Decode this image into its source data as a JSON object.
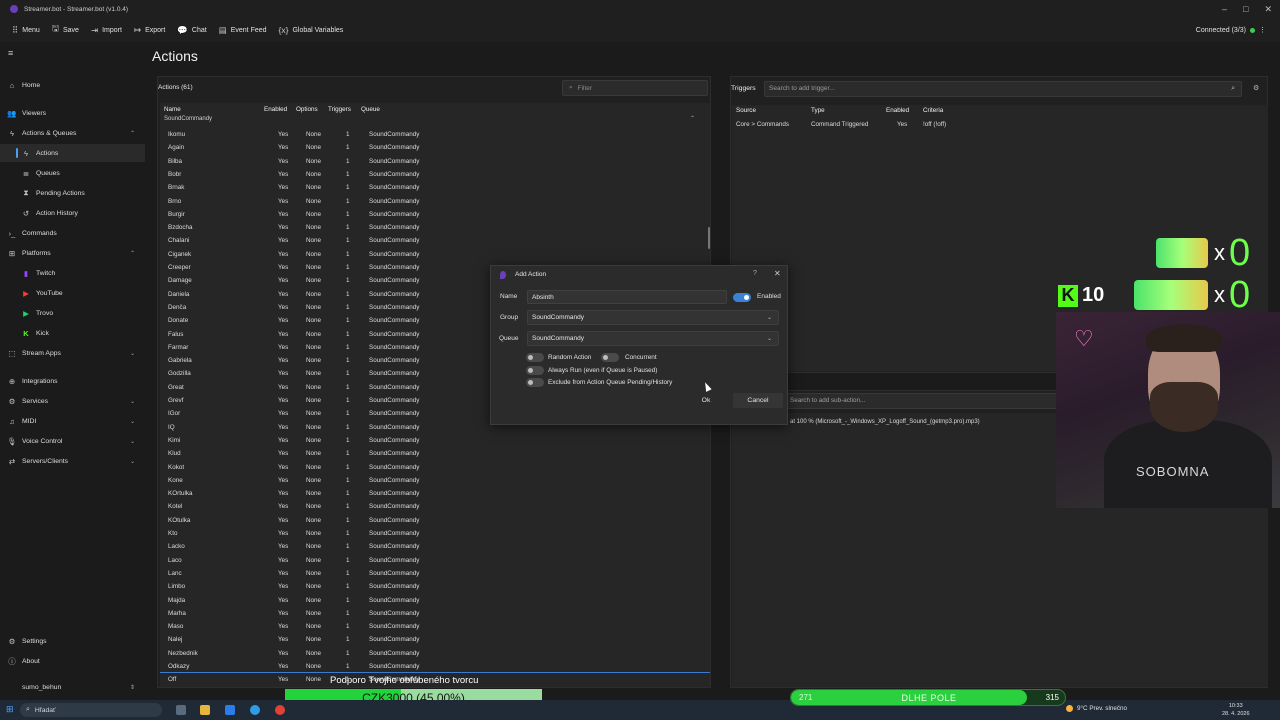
{
  "window": {
    "title": "Streamer.bot - Streamer.bot (v1.0.4)"
  },
  "toolbar": {
    "items": [
      {
        "label": "Menu",
        "icon": "grid-icon"
      },
      {
        "label": "Save",
        "icon": "save-icon"
      },
      {
        "label": "Import",
        "icon": "import-icon"
      },
      {
        "label": "Export",
        "icon": "export-icon"
      },
      {
        "label": "Chat",
        "icon": "chat-icon"
      },
      {
        "label": "Event Feed",
        "icon": "feed-icon"
      },
      {
        "label": "Global Variables",
        "icon": "variables-icon"
      }
    ],
    "connection": "Connected (3/3)"
  },
  "sidebar": {
    "items": [
      {
        "label": "Home",
        "icon": "home-icon"
      },
      {
        "label": "Viewers",
        "icon": "viewers-icon"
      },
      {
        "label": "Actions & Queues",
        "icon": "actions-icon"
      },
      {
        "label": "Actions",
        "icon": "bolt-icon"
      },
      {
        "label": "Queues",
        "icon": "queue-icon"
      },
      {
        "label": "Pending Actions",
        "icon": "pending-icon"
      },
      {
        "label": "Action History",
        "icon": "history-icon"
      },
      {
        "label": "Commands",
        "icon": "commands-icon"
      },
      {
        "label": "Platforms",
        "icon": "platforms-icon"
      },
      {
        "label": "Twitch",
        "icon": "twitch-icon"
      },
      {
        "label": "YouTube",
        "icon": "youtube-icon"
      },
      {
        "label": "Trovo",
        "icon": "trovo-icon"
      },
      {
        "label": "Kick",
        "icon": "kick-icon"
      },
      {
        "label": "Stream Apps",
        "icon": "stream-apps-icon"
      },
      {
        "label": "Integrations",
        "icon": "integrations-icon"
      },
      {
        "label": "Services",
        "icon": "services-icon"
      },
      {
        "label": "MIDI",
        "icon": "midi-icon"
      },
      {
        "label": "Voice Control",
        "icon": "voice-icon"
      },
      {
        "label": "Servers/Clients",
        "icon": "servers-icon"
      }
    ],
    "bottom": [
      {
        "label": "Settings",
        "icon": "gear-icon"
      },
      {
        "label": "About",
        "icon": "info-icon"
      }
    ],
    "user": "sumo_behun"
  },
  "page": {
    "title": "Actions"
  },
  "actions": {
    "label": "Actions",
    "count": "(61)",
    "filter_placeholder": "Filter",
    "columns": [
      "Name",
      "Enabled",
      "Options",
      "Triggers",
      "Queue"
    ],
    "group": "SoundCommandy",
    "enabled_value": "Yes",
    "options_value": "None",
    "triggers_value": "1",
    "queue_value": "SoundCommandy",
    "names": [
      "Ikomu",
      "Again",
      "Bilba",
      "Bobr",
      "Brnak",
      "Brno",
      "Burgir",
      "Bzdocha",
      "Chalani",
      "Ciganek",
      "Creeper",
      "Damage",
      "Daniela",
      "Denča",
      "Donate",
      "Falus",
      "Farmar",
      "Gabriela",
      "Godzilla",
      "Great",
      "Grevf",
      "IGor",
      "IQ",
      "Kimi",
      "Klud",
      "Kokot",
      "Kone",
      "KOrtulka",
      "Kotel",
      "KOtulka",
      "Kto",
      "Lacko",
      "Laco",
      "Lanc",
      "Limbo",
      "Majda",
      "Marha",
      "Maso",
      "Nalej",
      "Nezbednik",
      "Odkazy",
      "Off"
    ]
  },
  "triggers": {
    "label": "Triggers",
    "search_placeholder": "Search to add trigger...",
    "columns": [
      "Source",
      "Type",
      "Enabled",
      "Criteria"
    ],
    "row": {
      "source": "Core > Commands",
      "type": "Command Triggered",
      "enabled": "Yes",
      "criteria": "!off (!off)"
    }
  },
  "subactions": {
    "search_placeholder": "Search to add sub-action...",
    "row": "at 100 % (Microsoft_-_Windows_XP_Logoff_Sound_(getmp3.pro).mp3)"
  },
  "dialog": {
    "title": "Add Action",
    "help": "?",
    "name_label": "Name",
    "name_value": "Absinth",
    "enabled_label": "Enabled",
    "group_label": "Group",
    "group_value": "SoundCommandy",
    "queue_label": "Queue",
    "queue_value": "SoundCommandy",
    "options": {
      "random_action": "Random Action",
      "concurrent": "Concurrent",
      "always_run": "Always Run (even if Queue is Paused)",
      "exclude": "Exclude from Action Queue Pending/History"
    },
    "ok": "Ok",
    "cancel": "Cancel"
  },
  "overlay": {
    "kick_count": "10",
    "drink_multiplier": "x",
    "drink_count_1": "0",
    "drink_count_2": "0",
    "support_text": "Podporo Tvojho obľúbeného tvorcu",
    "goal_text": "CZK3000 (45.00%)",
    "goal_progress": 0.45,
    "level_min": "271",
    "level_name": "DLHE POLE",
    "level_max": "315",
    "level_progress": 0.86,
    "shirt_text": "SOBOMNA"
  },
  "taskbar": {
    "search_placeholder": "Hľadať",
    "weather": "9°C  Prev. slnečno",
    "time": "10:33",
    "date": "28. 4. 2026"
  },
  "colors": {
    "accent": "#3a82d8",
    "kick": "#53fc18",
    "goal": "#22d33b"
  }
}
